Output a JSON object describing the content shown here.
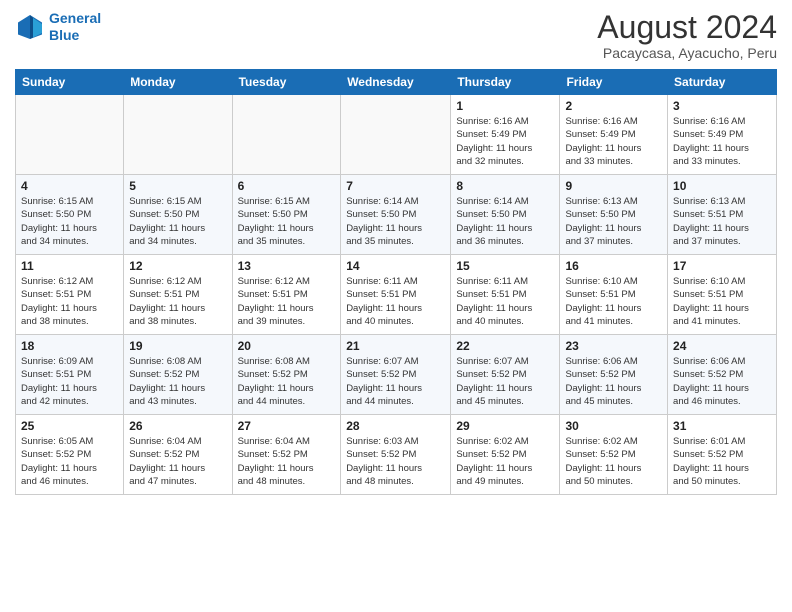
{
  "logo": {
    "line1": "General",
    "line2": "Blue"
  },
  "title": "August 2024",
  "subtitle": "Pacaycasa, Ayacucho, Peru",
  "weekdays": [
    "Sunday",
    "Monday",
    "Tuesday",
    "Wednesday",
    "Thursday",
    "Friday",
    "Saturday"
  ],
  "weeks": [
    [
      {
        "day": "",
        "info": ""
      },
      {
        "day": "",
        "info": ""
      },
      {
        "day": "",
        "info": ""
      },
      {
        "day": "",
        "info": ""
      },
      {
        "day": "1",
        "info": "Sunrise: 6:16 AM\nSunset: 5:49 PM\nDaylight: 11 hours\nand 32 minutes."
      },
      {
        "day": "2",
        "info": "Sunrise: 6:16 AM\nSunset: 5:49 PM\nDaylight: 11 hours\nand 33 minutes."
      },
      {
        "day": "3",
        "info": "Sunrise: 6:16 AM\nSunset: 5:49 PM\nDaylight: 11 hours\nand 33 minutes."
      }
    ],
    [
      {
        "day": "4",
        "info": "Sunrise: 6:15 AM\nSunset: 5:50 PM\nDaylight: 11 hours\nand 34 minutes."
      },
      {
        "day": "5",
        "info": "Sunrise: 6:15 AM\nSunset: 5:50 PM\nDaylight: 11 hours\nand 34 minutes."
      },
      {
        "day": "6",
        "info": "Sunrise: 6:15 AM\nSunset: 5:50 PM\nDaylight: 11 hours\nand 35 minutes."
      },
      {
        "day": "7",
        "info": "Sunrise: 6:14 AM\nSunset: 5:50 PM\nDaylight: 11 hours\nand 35 minutes."
      },
      {
        "day": "8",
        "info": "Sunrise: 6:14 AM\nSunset: 5:50 PM\nDaylight: 11 hours\nand 36 minutes."
      },
      {
        "day": "9",
        "info": "Sunrise: 6:13 AM\nSunset: 5:50 PM\nDaylight: 11 hours\nand 37 minutes."
      },
      {
        "day": "10",
        "info": "Sunrise: 6:13 AM\nSunset: 5:51 PM\nDaylight: 11 hours\nand 37 minutes."
      }
    ],
    [
      {
        "day": "11",
        "info": "Sunrise: 6:12 AM\nSunset: 5:51 PM\nDaylight: 11 hours\nand 38 minutes."
      },
      {
        "day": "12",
        "info": "Sunrise: 6:12 AM\nSunset: 5:51 PM\nDaylight: 11 hours\nand 38 minutes."
      },
      {
        "day": "13",
        "info": "Sunrise: 6:12 AM\nSunset: 5:51 PM\nDaylight: 11 hours\nand 39 minutes."
      },
      {
        "day": "14",
        "info": "Sunrise: 6:11 AM\nSunset: 5:51 PM\nDaylight: 11 hours\nand 40 minutes."
      },
      {
        "day": "15",
        "info": "Sunrise: 6:11 AM\nSunset: 5:51 PM\nDaylight: 11 hours\nand 40 minutes."
      },
      {
        "day": "16",
        "info": "Sunrise: 6:10 AM\nSunset: 5:51 PM\nDaylight: 11 hours\nand 41 minutes."
      },
      {
        "day": "17",
        "info": "Sunrise: 6:10 AM\nSunset: 5:51 PM\nDaylight: 11 hours\nand 41 minutes."
      }
    ],
    [
      {
        "day": "18",
        "info": "Sunrise: 6:09 AM\nSunset: 5:51 PM\nDaylight: 11 hours\nand 42 minutes."
      },
      {
        "day": "19",
        "info": "Sunrise: 6:08 AM\nSunset: 5:52 PM\nDaylight: 11 hours\nand 43 minutes."
      },
      {
        "day": "20",
        "info": "Sunrise: 6:08 AM\nSunset: 5:52 PM\nDaylight: 11 hours\nand 44 minutes."
      },
      {
        "day": "21",
        "info": "Sunrise: 6:07 AM\nSunset: 5:52 PM\nDaylight: 11 hours\nand 44 minutes."
      },
      {
        "day": "22",
        "info": "Sunrise: 6:07 AM\nSunset: 5:52 PM\nDaylight: 11 hours\nand 45 minutes."
      },
      {
        "day": "23",
        "info": "Sunrise: 6:06 AM\nSunset: 5:52 PM\nDaylight: 11 hours\nand 45 minutes."
      },
      {
        "day": "24",
        "info": "Sunrise: 6:06 AM\nSunset: 5:52 PM\nDaylight: 11 hours\nand 46 minutes."
      }
    ],
    [
      {
        "day": "25",
        "info": "Sunrise: 6:05 AM\nSunset: 5:52 PM\nDaylight: 11 hours\nand 46 minutes."
      },
      {
        "day": "26",
        "info": "Sunrise: 6:04 AM\nSunset: 5:52 PM\nDaylight: 11 hours\nand 47 minutes."
      },
      {
        "day": "27",
        "info": "Sunrise: 6:04 AM\nSunset: 5:52 PM\nDaylight: 11 hours\nand 48 minutes."
      },
      {
        "day": "28",
        "info": "Sunrise: 6:03 AM\nSunset: 5:52 PM\nDaylight: 11 hours\nand 48 minutes."
      },
      {
        "day": "29",
        "info": "Sunrise: 6:02 AM\nSunset: 5:52 PM\nDaylight: 11 hours\nand 49 minutes."
      },
      {
        "day": "30",
        "info": "Sunrise: 6:02 AM\nSunset: 5:52 PM\nDaylight: 11 hours\nand 50 minutes."
      },
      {
        "day": "31",
        "info": "Sunrise: 6:01 AM\nSunset: 5:52 PM\nDaylight: 11 hours\nand 50 minutes."
      }
    ]
  ]
}
